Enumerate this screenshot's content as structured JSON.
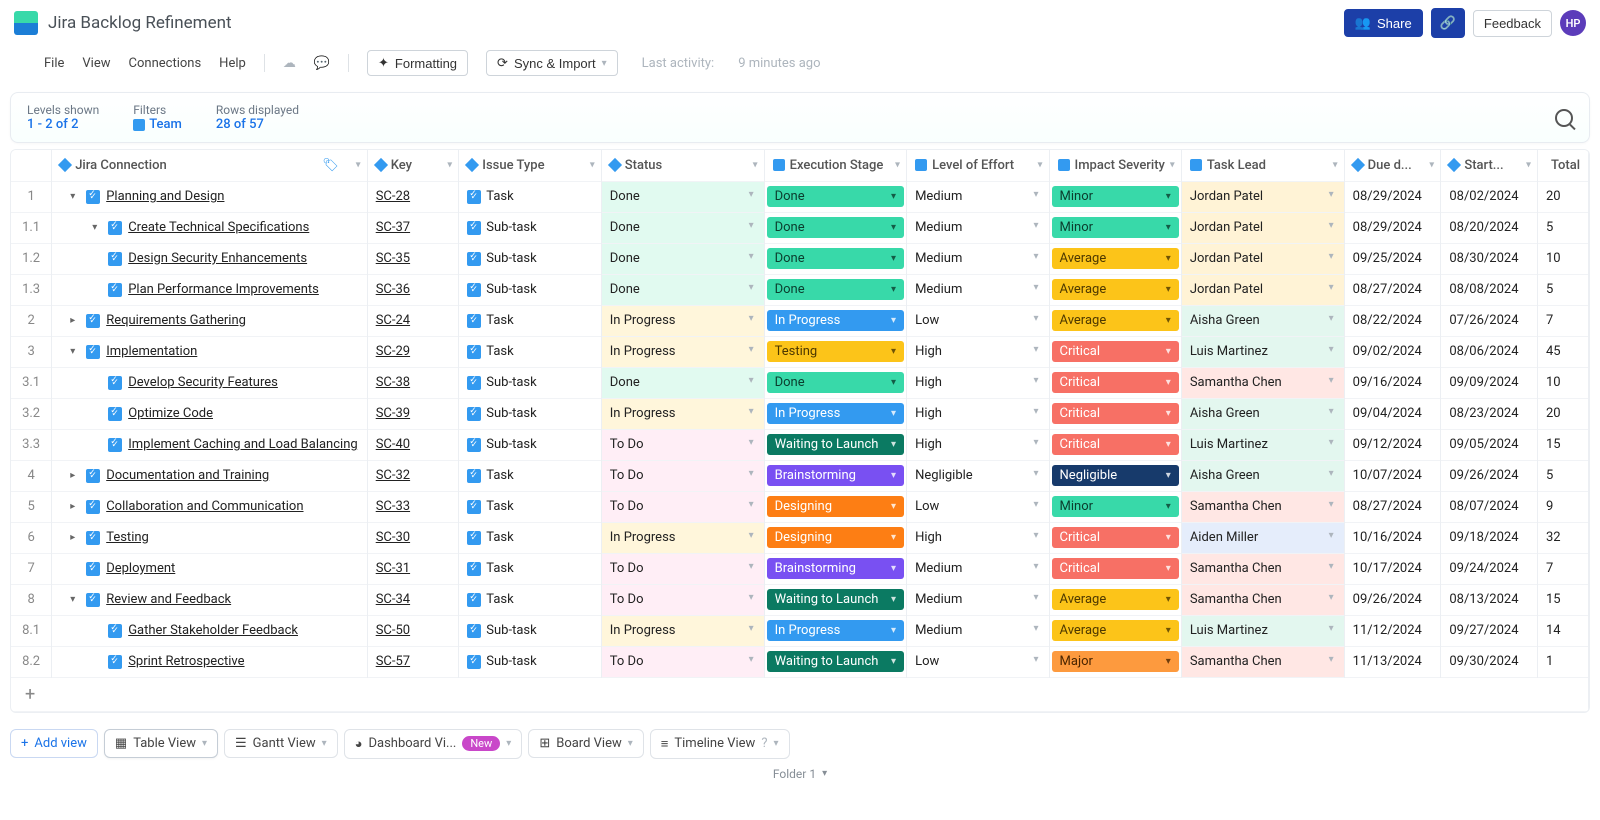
{
  "header": {
    "title": "Jira Backlog Refinement",
    "share": "Share",
    "feedback": "Feedback",
    "avatar": "HP"
  },
  "menu": {
    "file": "File",
    "view": "View",
    "connections": "Connections",
    "help": "Help",
    "formatting": "Formatting",
    "sync": "Sync & Import",
    "last_activity_label": "Last activity:",
    "last_activity_value": "9 minutes ago"
  },
  "summary": {
    "levels_label": "Levels shown",
    "levels_value": "1 - 2 of 2",
    "filters_label": "Filters",
    "filters_value": "Team",
    "rows_label": "Rows displayed",
    "rows_value": "28 of 57"
  },
  "columns": {
    "name": "Jira Connection",
    "key": "Key",
    "type": "Issue Type",
    "status": "Status",
    "exec": "Execution Stage",
    "effort": "Level of Effort",
    "impact": "Impact Severity",
    "lead": "Task Lead",
    "due": "Due d...",
    "start": "Start...",
    "total": "Total"
  },
  "rows": [
    {
      "num": "1",
      "indent": 0,
      "toggle": "▾",
      "name": "Planning and Design",
      "key": "SC-28",
      "type": "Task",
      "status": "Done",
      "exec": "Done",
      "exec_cls": "ex-done",
      "effort": "Medium",
      "impact": "Minor",
      "impact_cls": "im-minor",
      "lead": "Jordan Patel",
      "lead_cls": "ld-y",
      "due": "08/29/2024",
      "start": "08/02/2024",
      "total": "20"
    },
    {
      "num": "1.1",
      "indent": 1,
      "toggle": "▾",
      "name": "Create Technical Specifications",
      "key": "SC-37",
      "type": "Sub-task",
      "status": "Done",
      "exec": "Done",
      "exec_cls": "ex-done",
      "effort": "Medium",
      "impact": "Minor",
      "impact_cls": "im-minor",
      "lead": "Jordan Patel",
      "lead_cls": "ld-y",
      "due": "08/29/2024",
      "start": "08/20/2024",
      "total": "5"
    },
    {
      "num": "1.2",
      "indent": 1,
      "toggle": "",
      "name": "Design Security Enhancements",
      "key": "SC-35",
      "type": "Sub-task",
      "status": "Done",
      "exec": "Done",
      "exec_cls": "ex-done",
      "effort": "Medium",
      "impact": "Average",
      "impact_cls": "im-avg",
      "lead": "Jordan Patel",
      "lead_cls": "ld-y",
      "due": "09/25/2024",
      "start": "08/30/2024",
      "total": "10"
    },
    {
      "num": "1.3",
      "indent": 1,
      "toggle": "",
      "name": "Plan Performance Improvements",
      "key": "SC-36",
      "type": "Sub-task",
      "status": "Done",
      "exec": "Done",
      "exec_cls": "ex-done",
      "effort": "Medium",
      "impact": "Average",
      "impact_cls": "im-avg",
      "lead": "Jordan Patel",
      "lead_cls": "ld-y",
      "due": "08/27/2024",
      "start": "08/08/2024",
      "total": "5"
    },
    {
      "num": "2",
      "indent": 0,
      "toggle": "▸",
      "name": "Requirements Gathering",
      "key": "SC-24",
      "type": "Task",
      "status": "In Progress",
      "exec": "In Progress",
      "exec_cls": "ex-prog",
      "effort": "Low",
      "impact": "Average",
      "impact_cls": "im-avg",
      "lead": "Aisha Green",
      "lead_cls": "ld-g",
      "due": "08/22/2024",
      "start": "07/26/2024",
      "total": "7"
    },
    {
      "num": "3",
      "indent": 0,
      "toggle": "▾",
      "name": "Implementation",
      "key": "SC-29",
      "type": "Task",
      "status": "In Progress",
      "exec": "Testing",
      "exec_cls": "ex-testing",
      "effort": "High",
      "impact": "Critical",
      "impact_cls": "im-crit",
      "lead": "Luis Martinez",
      "lead_cls": "ld-g",
      "due": "09/02/2024",
      "start": "08/06/2024",
      "total": "45"
    },
    {
      "num": "3.1",
      "indent": 1,
      "toggle": "",
      "name": "Develop Security Features",
      "key": "SC-38",
      "type": "Sub-task",
      "status": "Done",
      "exec": "Done",
      "exec_cls": "ex-done",
      "effort": "High",
      "impact": "Critical",
      "impact_cls": "im-crit",
      "lead": "Samantha Chen",
      "lead_cls": "ld-p",
      "due": "09/16/2024",
      "start": "09/09/2024",
      "total": "10"
    },
    {
      "num": "3.2",
      "indent": 1,
      "toggle": "",
      "name": "Optimize Code",
      "key": "SC-39",
      "type": "Sub-task",
      "status": "In Progress",
      "exec": "In Progress",
      "exec_cls": "ex-prog",
      "effort": "High",
      "impact": "Critical",
      "impact_cls": "im-crit",
      "lead": "Aisha Green",
      "lead_cls": "ld-g",
      "due": "09/04/2024",
      "start": "08/23/2024",
      "total": "20"
    },
    {
      "num": "3.3",
      "indent": 1,
      "toggle": "",
      "name": "Implement Caching and Load Balancing",
      "key": "SC-40",
      "type": "Sub-task",
      "status": "To Do",
      "exec": "Waiting to Launch",
      "exec_cls": "ex-wait",
      "effort": "High",
      "impact": "Critical",
      "impact_cls": "im-crit",
      "lead": "Luis Martinez",
      "lead_cls": "ld-g",
      "due": "09/12/2024",
      "start": "09/05/2024",
      "total": "15"
    },
    {
      "num": "4",
      "indent": 0,
      "toggle": "▸",
      "name": "Documentation and Training",
      "key": "SC-32",
      "type": "Task",
      "status": "To Do",
      "exec": "Brainstorming",
      "exec_cls": "ex-brain",
      "effort": "Negligible",
      "impact": "Negligible",
      "impact_cls": "im-neg",
      "lead": "Aisha Green",
      "lead_cls": "ld-g",
      "due": "10/07/2024",
      "start": "09/26/2024",
      "total": "5"
    },
    {
      "num": "5",
      "indent": 0,
      "toggle": "▸",
      "name": "Collaboration and Communication",
      "key": "SC-33",
      "type": "Task",
      "status": "To Do",
      "exec": "Designing",
      "exec_cls": "ex-design",
      "effort": "Low",
      "impact": "Minor",
      "impact_cls": "im-minor",
      "lead": "Samantha Chen",
      "lead_cls": "ld-p",
      "due": "08/27/2024",
      "start": "08/07/2024",
      "total": "9"
    },
    {
      "num": "6",
      "indent": 0,
      "toggle": "▸",
      "name": "Testing",
      "key": "SC-30",
      "type": "Task",
      "status": "In Progress",
      "exec": "Designing",
      "exec_cls": "ex-design",
      "effort": "High",
      "impact": "Critical",
      "impact_cls": "im-crit",
      "lead": "Aiden Miller",
      "lead_cls": "ld-b",
      "due": "10/16/2024",
      "start": "09/18/2024",
      "total": "32"
    },
    {
      "num": "7",
      "indent": 0,
      "toggle": "",
      "name": "Deployment",
      "key": "SC-31",
      "type": "Task",
      "status": "To Do",
      "exec": "Brainstorming",
      "exec_cls": "ex-brain",
      "effort": "Medium",
      "impact": "Critical",
      "impact_cls": "im-crit",
      "lead": "Samantha Chen",
      "lead_cls": "ld-p",
      "due": "10/17/2024",
      "start": "09/24/2024",
      "total": "7"
    },
    {
      "num": "8",
      "indent": 0,
      "toggle": "▾",
      "name": "Review and Feedback",
      "key": "SC-34",
      "type": "Task",
      "status": "To Do",
      "exec": "Waiting to Launch",
      "exec_cls": "ex-wait",
      "effort": "Medium",
      "impact": "Average",
      "impact_cls": "im-avg",
      "lead": "Samantha Chen",
      "lead_cls": "ld-p",
      "due": "09/26/2024",
      "start": "08/13/2024",
      "total": "15"
    },
    {
      "num": "8.1",
      "indent": 1,
      "toggle": "",
      "name": "Gather Stakeholder Feedback",
      "key": "SC-50",
      "type": "Sub-task",
      "status": "In Progress",
      "exec": "In Progress",
      "exec_cls": "ex-prog",
      "effort": "Medium",
      "impact": "Average",
      "impact_cls": "im-avg",
      "lead": "Luis Martinez",
      "lead_cls": "ld-g",
      "due": "11/12/2024",
      "start": "09/27/2024",
      "total": "14"
    },
    {
      "num": "8.2",
      "indent": 1,
      "toggle": "",
      "name": "Sprint Retrospective",
      "key": "SC-57",
      "type": "Sub-task",
      "status": "To Do",
      "exec": "Waiting to Launch",
      "exec_cls": "ex-wait",
      "effort": "Low",
      "impact": "Major",
      "impact_cls": "im-major",
      "lead": "Samantha Chen",
      "lead_cls": "ld-p",
      "due": "11/13/2024",
      "start": "09/30/2024",
      "total": "1"
    }
  ],
  "tabs": {
    "add": "Add view",
    "table": "Table View",
    "gantt": "Gantt View",
    "dash": "Dashboard Vi...",
    "new": "New",
    "board": "Board View",
    "timeline": "Timeline View"
  },
  "footer": {
    "folder": "Folder 1"
  }
}
